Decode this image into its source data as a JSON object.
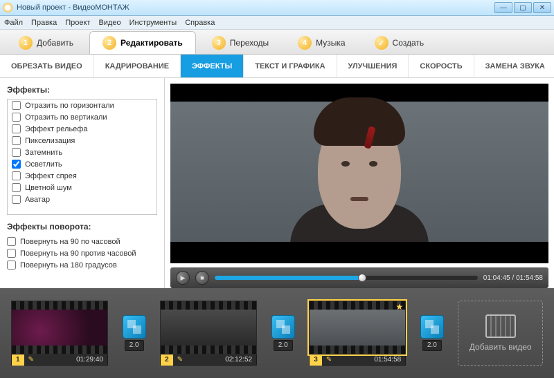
{
  "titlebar": {
    "title": "Новый проект - ВидеоМОНТАЖ"
  },
  "menu": [
    "Файл",
    "Правка",
    "Проект",
    "Видео",
    "Инструменты",
    "Справка"
  ],
  "steps": [
    {
      "num": "1",
      "label": "Добавить",
      "active": false
    },
    {
      "num": "2",
      "label": "Редактировать",
      "active": true
    },
    {
      "num": "3",
      "label": "Переходы",
      "active": false
    },
    {
      "num": "4",
      "label": "Музыка",
      "active": false
    },
    {
      "num": "✓",
      "label": "Создать",
      "active": false
    }
  ],
  "subtabs": [
    "ОБРЕЗАТЬ ВИДЕО",
    "КАДРИРОВАНИЕ",
    "ЭФФЕКТЫ",
    "ТЕКСТ И ГРАФИКА",
    "УЛУЧШЕНИЯ",
    "СКОРОСТЬ",
    "ЗАМЕНА ЗВУКА"
  ],
  "subtab_active_index": 2,
  "sidebar": {
    "effects_title": "Эффекты:",
    "effects": [
      {
        "label": "Отразить по горизонтали",
        "checked": false
      },
      {
        "label": "Отразить по вертикали",
        "checked": false
      },
      {
        "label": "Эффект рельефа",
        "checked": false
      },
      {
        "label": "Пикселизация",
        "checked": false
      },
      {
        "label": "Затемнить",
        "checked": false
      },
      {
        "label": "Осветлить",
        "checked": true
      },
      {
        "label": "Эффект спрея",
        "checked": false
      },
      {
        "label": "Цветной шум",
        "checked": false
      },
      {
        "label": "Аватар",
        "checked": false
      }
    ],
    "rotations_title": "Эффекты поворота:",
    "rotations": [
      {
        "label": "Повернуть на 90 по часовой",
        "checked": false
      },
      {
        "label": "Повернуть на 90 против часовой",
        "checked": false
      },
      {
        "label": "Повернуть на 180 градусов",
        "checked": false
      }
    ]
  },
  "player": {
    "time_current": "01:04:45",
    "time_total": "01:54:58",
    "progress": 0.56
  },
  "timeline": {
    "clips": [
      {
        "num": "1",
        "duration": "01:29:40",
        "selected": false,
        "thumb": "thumb1"
      },
      {
        "num": "2",
        "duration": "02:12:52",
        "selected": false,
        "thumb": "thumb2"
      },
      {
        "num": "3",
        "duration": "01:54:58",
        "selected": true,
        "thumb": "thumb3"
      }
    ],
    "transition_duration": "2.0",
    "add_video_label": "Добавить видео"
  }
}
